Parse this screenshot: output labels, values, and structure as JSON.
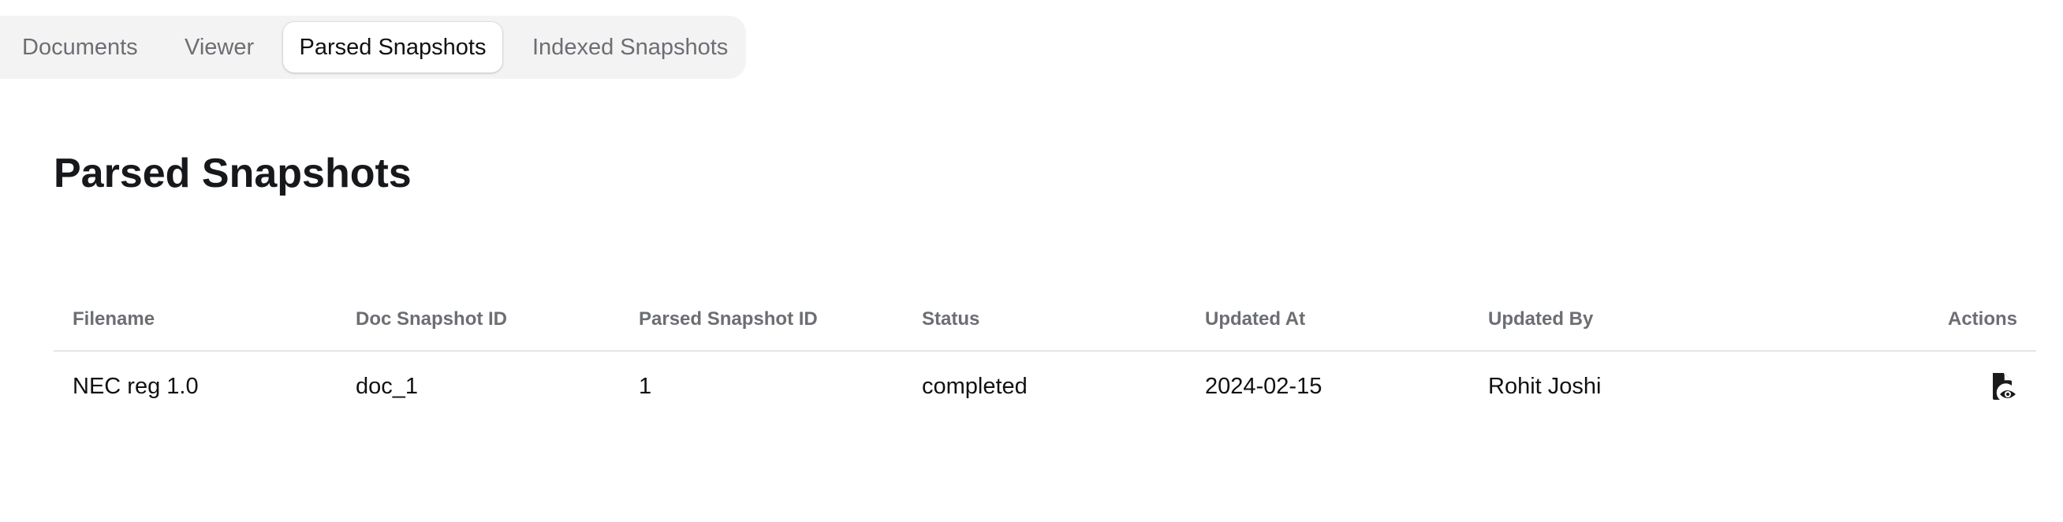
{
  "tabs": [
    {
      "label": "Documents",
      "active": false
    },
    {
      "label": "Viewer",
      "active": false
    },
    {
      "label": "Parsed Snapshots",
      "active": true
    },
    {
      "label": "Indexed Snapshots",
      "active": false
    }
  ],
  "page": {
    "title": "Parsed Snapshots"
  },
  "table": {
    "columns": [
      "Filename",
      "Doc Snapshot ID",
      "Parsed Snapshot ID",
      "Status",
      "Updated At",
      "Updated By",
      "Actions"
    ],
    "rows": [
      {
        "filename": "NEC reg 1.0",
        "doc_snapshot_id": "doc_1",
        "parsed_snapshot_id": "1",
        "status": "completed",
        "updated_at": "2024-02-15",
        "updated_by": "Rohit Joshi",
        "action_icon": "file-view-icon"
      }
    ]
  },
  "colors": {
    "text": "#111111",
    "muted": "#6b6e73",
    "tab_bar_bg": "#f3f3f3",
    "divider": "#e4e4e4"
  }
}
